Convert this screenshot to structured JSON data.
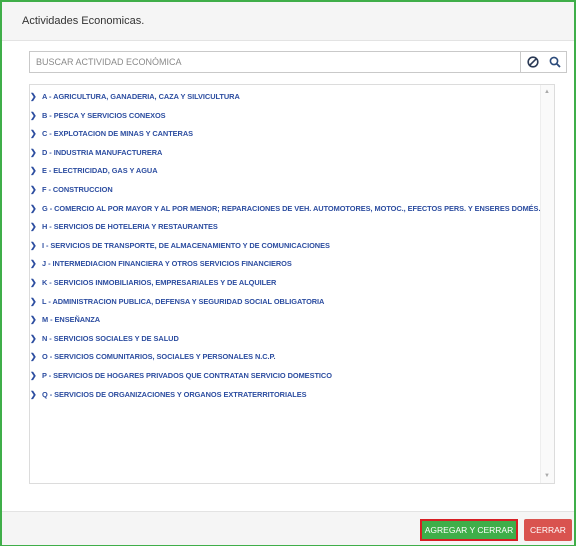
{
  "header": {
    "title": "Actividades Economicas."
  },
  "search": {
    "placeholder": "BUSCAR ACTIVIDAD ECONÓMICA",
    "value": "",
    "clear_icon": "no-entry-icon",
    "search_icon": "search-icon"
  },
  "tree": {
    "items": [
      {
        "label": "A - AGRICULTURA, GANADERIA, CAZA Y SILVICULTURA"
      },
      {
        "label": "B - PESCA Y SERVICIOS CONEXOS"
      },
      {
        "label": "C - EXPLOTACION DE MINAS Y CANTERAS"
      },
      {
        "label": "D - INDUSTRIA MANUFACTURERA"
      },
      {
        "label": "E - ELECTRICIDAD, GAS Y AGUA"
      },
      {
        "label": "F - CONSTRUCCION"
      },
      {
        "label": "G - COMERCIO AL POR MAYOR Y AL POR MENOR; REPARACIONES DE VEH. AUTOMOTORES, MOTOC., EFECTOS PERS. Y ENSERES DOMÉS."
      },
      {
        "label": "H - SERVICIOS DE HOTELERIA Y RESTAURANTES"
      },
      {
        "label": "I - SERVICIOS DE TRANSPORTE, DE ALMACENAMIENTO Y DE COMUNICACIONES"
      },
      {
        "label": "J - INTERMEDIACION FINANCIERA Y OTROS SERVICIOS FINANCIEROS"
      },
      {
        "label": "K - SERVICIOS INMOBILIARIOS, EMPRESARIALES Y DE ALQUILER"
      },
      {
        "label": "L - ADMINISTRACION PUBLICA, DEFENSA Y SEGURIDAD SOCIAL OBLIGATORIA"
      },
      {
        "label": "M - ENSEÑANZA"
      },
      {
        "label": "N - SERVICIOS SOCIALES Y DE SALUD"
      },
      {
        "label": "O - SERVICIOS COMUNITARIOS, SOCIALES Y PERSONALES N.C.P."
      },
      {
        "label": "P - SERVICIOS DE HOGARES PRIVADOS QUE CONTRATAN SERVICIO DOMESTICO"
      },
      {
        "label": "Q - SERVICIOS DE ORGANIZACIONES Y ORGANOS EXTRATERRITORIALES"
      }
    ]
  },
  "footer": {
    "add_label": "AGREGAR Y CERRAR",
    "close_label": "CERRAR"
  },
  "colors": {
    "accent_green": "#3fae49",
    "danger_red": "#d9534f",
    "link_blue": "#2c4da0",
    "highlight_border": "#d71f24"
  }
}
